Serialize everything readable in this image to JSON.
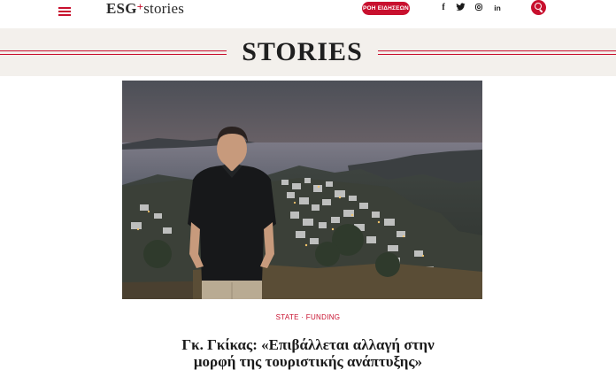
{
  "header": {
    "logo_esg": "ESG",
    "logo_stories": "stories",
    "stream_button": "ΡΟΗ ΕΙΔΗΣΕΩΝ",
    "social": {
      "facebook": "f",
      "twitter": "twitter",
      "instagram": "instagram",
      "linkedin": "in"
    },
    "colors": {
      "accent": "#c8102e",
      "banner_bg": "#f3f0ec"
    }
  },
  "section": {
    "title": "STORIES"
  },
  "article": {
    "category": "STATE · FUNDING",
    "headline": "Γκ. Γκίκας: «Επιβάλλεται αλλαγή στην μορφή της τουριστικής ανάπτυξης»",
    "image": "photo of man in black polo shirt standing in front of an island village at dusk"
  }
}
